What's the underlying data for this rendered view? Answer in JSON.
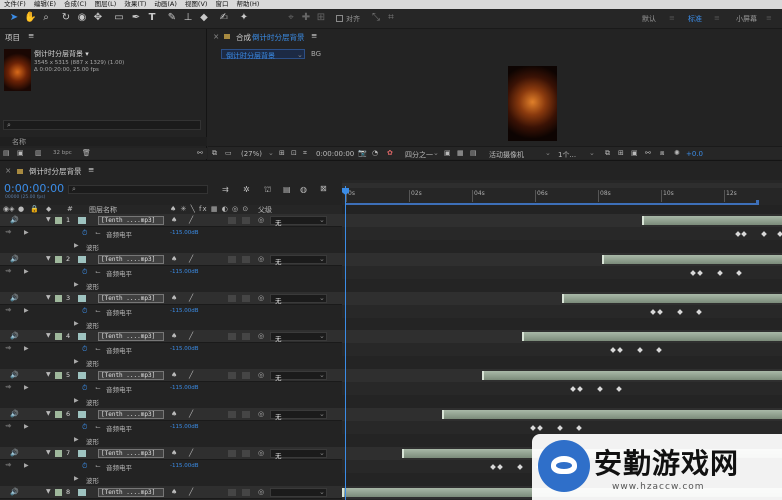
{
  "menu": [
    "文件(F)",
    "编辑(E)",
    "合成(C)",
    "图层(L)",
    "效果(T)",
    "动画(A)",
    "视图(V)",
    "窗口",
    "帮助(H)"
  ],
  "toolbar": {
    "snap_label": "对齐",
    "workspaces": [
      "默认",
      "标准",
      "小屏幕"
    ],
    "active_workspace_color": "#3b8ce6"
  },
  "project": {
    "title": "项目",
    "item_name": "倒计时分层背景 ▾",
    "item_info1": "3545 x 5315 (887 x 1329) (1.00)",
    "item_info2": "Δ 0:00:20:00, 25.00 fps",
    "column_name": "名称",
    "bpc": "32 bpc"
  },
  "composition": {
    "title_prefix": "合成",
    "title_name": "倒计时分层背景",
    "tab_label": "倒计时分层背景",
    "bg_label": "BG",
    "zoom": "(27%)",
    "timecode": "0:00:00:00",
    "resolution": "四分之一",
    "camera": "活动摄像机",
    "views": "1个...",
    "exposure": "+0.0"
  },
  "timeline": {
    "title": "倒计时分层背景",
    "timecode": "0:00:00:00",
    "frame_info": "00000 (25.00 fps)",
    "col_layer_name": "图层名称",
    "col_parent": "父级",
    "ruler_labels": [
      "0s",
      "02s",
      "04s",
      "06s",
      "08s",
      "10s",
      "12s"
    ],
    "layers": [
      {
        "num": "1",
        "name": "[Tenth ....mp3]",
        "sub1": "音频电平",
        "value": "-115.00dB",
        "sub2": "波形",
        "parent": "无",
        "bar_start": 0.681,
        "keys": [
          0.895,
          0.91,
          0.955,
          0.99
        ]
      },
      {
        "num": "2",
        "name": "[Tenth ....mp3]",
        "sub1": "音频电平",
        "value": "-115.00dB",
        "sub2": "波形",
        "parent": "无",
        "bar_start": 0.59,
        "keys": [
          0.794,
          0.808,
          0.854,
          0.898
        ]
      },
      {
        "num": "3",
        "name": "[Tenth ....mp3]",
        "sub1": "音频电平",
        "value": "-115.00dB",
        "sub2": "波形",
        "parent": "无",
        "bar_start": 0.5,
        "keys": [
          0.703,
          0.718,
          0.763,
          0.807
        ]
      },
      {
        "num": "4",
        "name": "[Tenth ....mp3]",
        "sub1": "音频电平",
        "value": "-115.00dB",
        "sub2": "波形",
        "parent": "无",
        "bar_start": 0.409,
        "keys": [
          0.612,
          0.627,
          0.672,
          0.716
        ]
      },
      {
        "num": "5",
        "name": "[Tenth ....mp3]",
        "sub1": "音频电平",
        "value": "-115.00dB",
        "sub2": "波形",
        "parent": "无",
        "bar_start": 0.318,
        "keys": [
          0.521,
          0.536,
          0.581,
          0.625
        ]
      },
      {
        "num": "6",
        "name": "[Tenth ....mp3]",
        "sub1": "音频电平",
        "value": "-115.00dB",
        "sub2": "波形",
        "parent": "无",
        "bar_start": 0.227,
        "keys": [
          0.43,
          0.445,
          0.49,
          0.534
        ]
      },
      {
        "num": "7",
        "name": "[Tenth ....mp3]",
        "sub1": "音频电平",
        "value": "-115.00dB",
        "sub2": "波形",
        "parent": "无",
        "bar_start": 0.136,
        "keys": [
          0.339,
          0.354,
          0.399,
          0.443
        ]
      },
      {
        "num": "8",
        "name": "[Tenth ....mp3]",
        "sub1": "",
        "value": "",
        "sub2": "",
        "parent": "",
        "bar_start": 0.0,
        "keys": []
      }
    ]
  },
  "watermark": {
    "text": "安勤游戏网",
    "url": "www.hzaccw.com"
  }
}
